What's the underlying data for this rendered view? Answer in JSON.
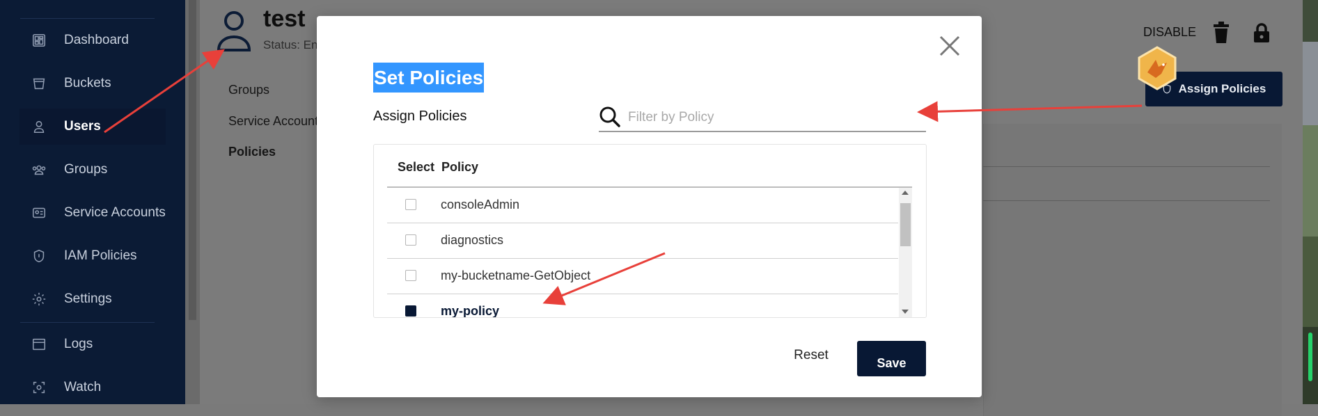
{
  "sidebar": {
    "items": [
      {
        "label": "Dashboard",
        "icon": "dashboard-icon"
      },
      {
        "label": "Buckets",
        "icon": "bucket-icon"
      },
      {
        "label": "Users",
        "icon": "user-icon"
      },
      {
        "label": "Groups",
        "icon": "groups-icon"
      },
      {
        "label": "Service Accounts",
        "icon": "id-card-icon"
      },
      {
        "label": "IAM Policies",
        "icon": "shield-icon"
      },
      {
        "label": "Settings",
        "icon": "gear-icon"
      },
      {
        "label": "Logs",
        "icon": "logs-icon"
      },
      {
        "label": "Watch",
        "icon": "watch-icon"
      }
    ],
    "active": "Users"
  },
  "user": {
    "name": "test",
    "status": "Status: En"
  },
  "header_actions": {
    "disable_label": "DISABLE",
    "assign_policies_label": "Assign Policies"
  },
  "tabs": [
    "Groups",
    "Service Accounts",
    "Policies"
  ],
  "modal": {
    "title": "Set Policies",
    "assign_label": "Assign Policies",
    "search_placeholder": "Filter by Policy",
    "columns": {
      "select": "Select",
      "policy": "Policy"
    },
    "policies": [
      {
        "name": "consoleAdmin",
        "checked": false
      },
      {
        "name": "diagnostics",
        "checked": false
      },
      {
        "name": "my-bucketname-GetObject",
        "checked": false
      },
      {
        "name": "my-policy",
        "checked": true
      }
    ],
    "reset_label": "Reset",
    "save_label": "Save"
  },
  "colors": {
    "sidebar_bg": "#0b1b35",
    "primary": "#081834",
    "title_highlight": "#3396ff",
    "annotation_arrow": "#e8403a"
  }
}
